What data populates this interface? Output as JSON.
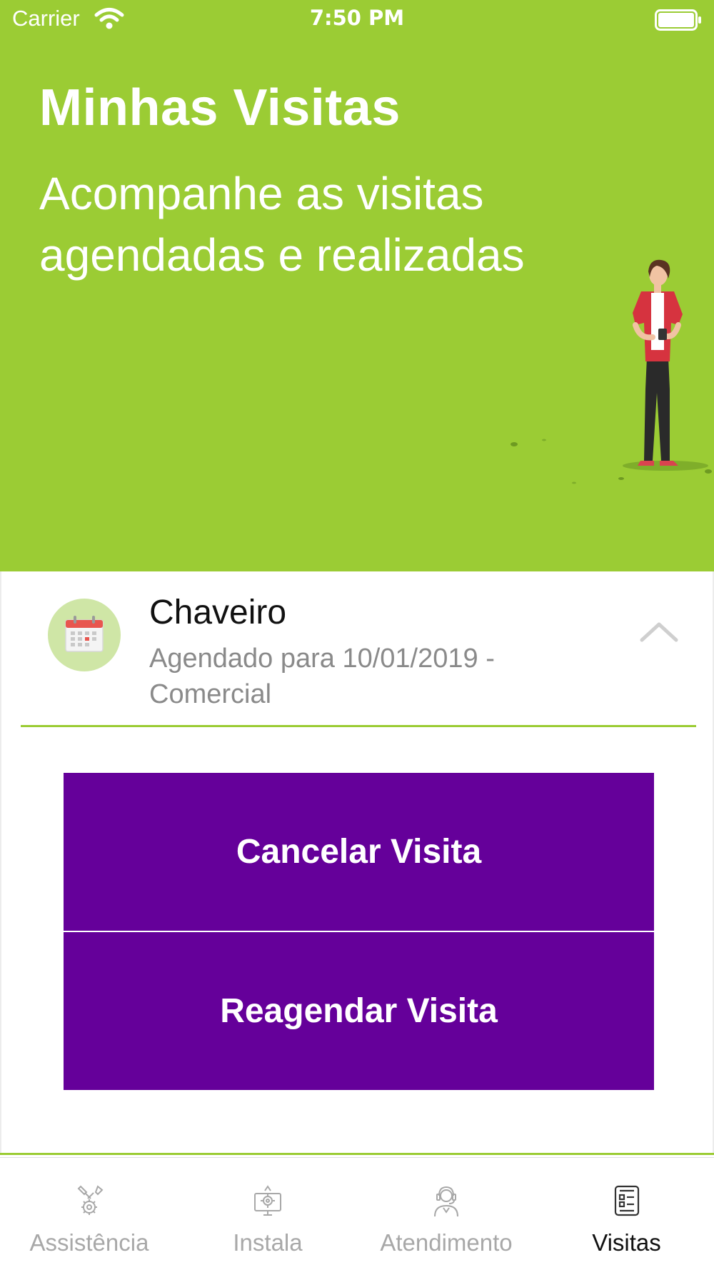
{
  "status_bar": {
    "carrier": "Carrier",
    "time": "7:50 PM"
  },
  "header": {
    "title": "Minhas Visitas",
    "subtitle": "Acompanhe as visitas agendadas e realizadas",
    "background_color": "#9bcc34"
  },
  "visit": {
    "icon": "calendar-icon",
    "title": "Chaveiro",
    "subtitle": "Agendado para 10/01/2019 - Comercial",
    "expanded": true
  },
  "actions": {
    "cancel_label": "Cancelar Visita",
    "reschedule_label": "Reagendar Visita",
    "button_color": "#65009a"
  },
  "tab_bar": {
    "tabs": [
      {
        "label": "Assistência",
        "icon": "tools-gear-icon",
        "active": false
      },
      {
        "label": "Instala",
        "icon": "monitor-gear-icon",
        "active": false
      },
      {
        "label": "Atendimento",
        "icon": "support-agent-icon",
        "active": false
      },
      {
        "label": "Visitas",
        "icon": "checklist-icon",
        "active": true
      }
    ]
  }
}
